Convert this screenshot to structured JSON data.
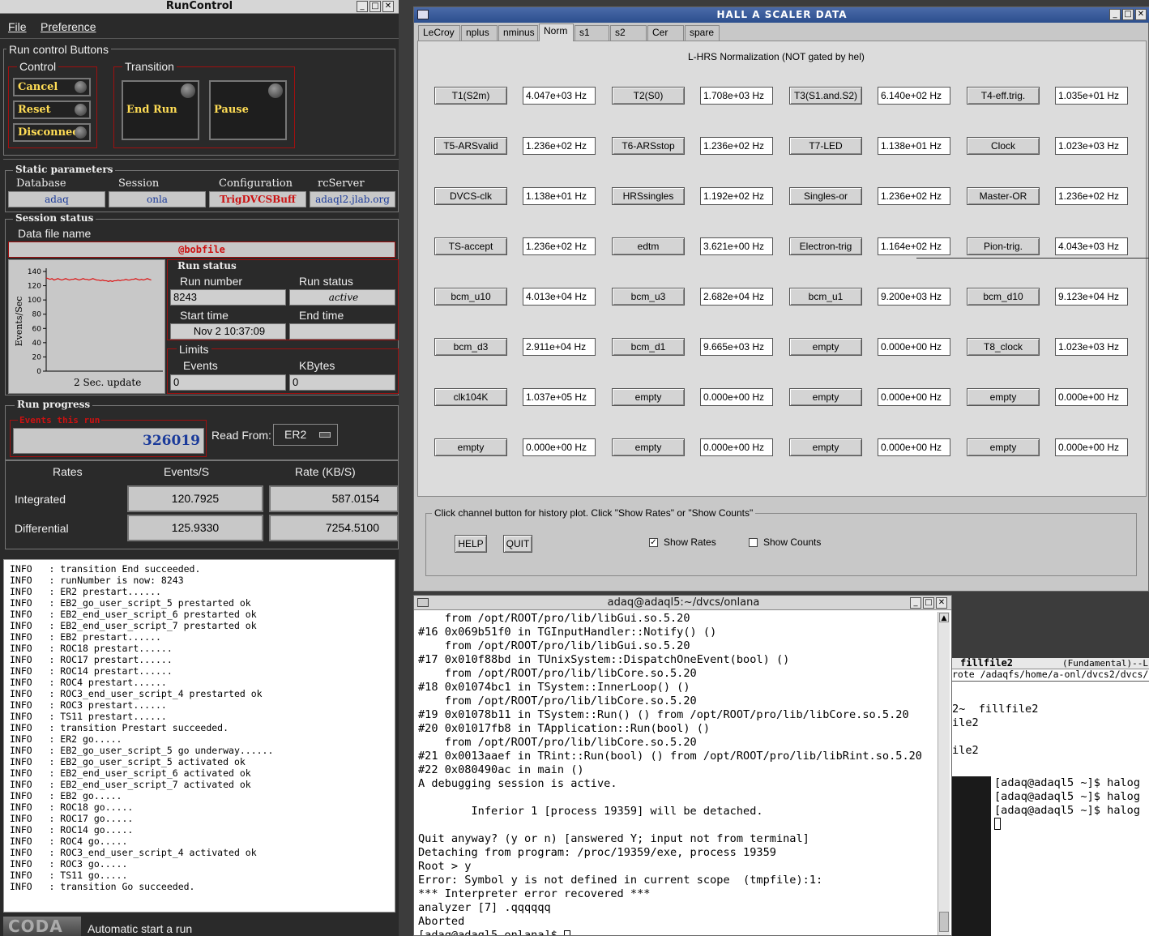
{
  "runcontrol": {
    "title": "RunControl",
    "menu": [
      "File",
      "Preference"
    ],
    "buttons_group": "Run control Buttons",
    "control_group": "Control",
    "cancel": "Cancel",
    "reset": "Reset",
    "disconnect": "Disconnect",
    "transition_group": "Transition",
    "end_run": "End Run",
    "pause": "Pause",
    "static_params": "Static parameters",
    "database_label": "Database",
    "database": "adaq",
    "session_label": "Session",
    "session": "onla",
    "config_label": "Configuration",
    "config": "TrigDVCSBuff",
    "rcserver_label": "rcServer",
    "rcserver": "adaql2.jlab.org",
    "session_status": "Session status",
    "datafile_label": "Data file name",
    "datafile": "@bobfile",
    "chart_update": "2 Sec. update",
    "run_status_group": "Run status",
    "run_number_label": "Run number",
    "run_number": "8243",
    "run_status_label": "Run status",
    "run_status": "active",
    "start_time_label": "Start time",
    "start_time": "Nov 2 10:37:09",
    "end_time_label": "End time",
    "end_time": "",
    "limits_group": "Limits",
    "events_label": "Events",
    "events_limit": "0",
    "kbytes_label": "KBytes",
    "kbytes_limit": "0",
    "run_progress": "Run progress",
    "events_this_run_label": "Events this run",
    "events_this_run": "326019",
    "read_from_label": "Read From:",
    "read_from": "ER2",
    "rates_label": "Rates",
    "events_s_label": "Events/S",
    "rate_kbs_label": "Rate (KB/S)",
    "integrated_label": "Integrated",
    "integrated_events": "120.7925",
    "integrated_rate": "587.0154",
    "differential_label": "Differential",
    "differential_events": "125.9330",
    "differential_rate": "7254.5100",
    "status_text": "Automatic start a run",
    "log": [
      "INFO   : transition End succeeded.",
      "INFO   : runNumber is now: 8243",
      "INFO   : ER2 prestart......",
      "INFO   : EB2_go_user_script_5 prestarted ok",
      "INFO   : EB2_end_user_script_6 prestarted ok",
      "INFO   : EB2_end_user_script_7 prestarted ok",
      "INFO   : EB2 prestart......",
      "INFO   : ROC18 prestart......",
      "INFO   : ROC17 prestart......",
      "INFO   : ROC14 prestart......",
      "INFO   : ROC4 prestart......",
      "INFO   : ROC3_end_user_script_4 prestarted ok",
      "INFO   : ROC3 prestart......",
      "INFO   : TS11 prestart......",
      "INFO   : transition Prestart succeeded.",
      "INFO   : ER2 go.....",
      "INFO   : EB2_go_user_script_5 go underway......",
      "INFO   : EB2_go_user_script_5 activated ok",
      "INFO   : EB2_end_user_script_6 activated ok",
      "INFO   : EB2_end_user_script_7 activated ok",
      "INFO   : EB2 go.....",
      "INFO   : ROC18 go.....",
      "INFO   : ROC17 go.....",
      "INFO   : ROC14 go.....",
      "INFO   : ROC4 go.....",
      "INFO   : ROC3_end_user_script_4 activated ok",
      "INFO   : ROC3 go.....",
      "INFO   : TS11 go.....",
      "INFO   : transition Go succeeded."
    ]
  },
  "chart_data": {
    "type": "line",
    "ylabel": "Events/Sec",
    "ylim": [
      0,
      140
    ],
    "yticks": [
      0,
      20,
      40,
      60,
      80,
      100,
      120,
      140
    ],
    "x": [
      0,
      1,
      2,
      3,
      4,
      5,
      6,
      7,
      8,
      9,
      10,
      11,
      12,
      13,
      14,
      15,
      16,
      17,
      18,
      19,
      20,
      21,
      22,
      23,
      24,
      25,
      26,
      27,
      28,
      29,
      30,
      31,
      32,
      33,
      34,
      35,
      36,
      37,
      38,
      39,
      40,
      41,
      42,
      43,
      44,
      45,
      46,
      47,
      48,
      49,
      50,
      51,
      52,
      53,
      54
    ],
    "values": [
      131,
      130,
      129,
      130,
      128,
      129,
      130,
      129,
      128,
      129,
      130,
      129,
      128,
      129,
      129,
      130,
      129,
      128,
      129,
      130,
      129,
      129,
      128,
      129,
      130,
      129,
      128,
      128,
      127,
      128,
      127,
      127,
      126,
      127,
      126,
      127,
      127,
      128,
      127,
      128,
      128,
      129,
      128,
      128,
      129,
      129,
      130,
      129,
      128,
      129,
      128,
      129,
      130,
      129,
      128
    ],
    "xlim": [
      0,
      60
    ],
    "color": "#dd1111"
  },
  "scaler": {
    "title": "HALL  A  SCALER  DATA",
    "tabs": [
      "LeCroy",
      "nplus",
      "nminus",
      "Norm",
      "s1",
      "s2",
      "Cer",
      "spare"
    ],
    "active_tab": 3,
    "heading": "L-HRS Normalization (NOT gated by hel)",
    "rows": [
      [
        [
          "T1(S2m)",
          "4.047e+03 Hz"
        ],
        [
          "T2(S0)",
          "1.708e+03 Hz"
        ],
        [
          "T3(S1.and.S2)",
          "6.140e+02 Hz"
        ],
        [
          "T4-eff.trig.",
          "1.035e+01 Hz"
        ]
      ],
      [
        [
          "T5-ARSvalid",
          "1.236e+02 Hz"
        ],
        [
          "T6-ARSstop",
          "1.236e+02 Hz"
        ],
        [
          "T7-LED",
          "1.138e+01 Hz"
        ],
        [
          "Clock",
          "1.023e+03 Hz"
        ]
      ],
      [
        [
          "DVCS-clk",
          "1.138e+01 Hz"
        ],
        [
          "HRSsingles",
          "1.192e+02 Hz"
        ],
        [
          "Singles-or",
          "1.236e+02 Hz"
        ],
        [
          "Master-OR",
          "1.236e+02 Hz"
        ]
      ],
      [
        [
          "TS-accept",
          "1.236e+02 Hz"
        ],
        [
          "edtm",
          "3.621e+00 Hz"
        ],
        [
          "Electron-trig",
          "1.164e+02 Hz"
        ],
        [
          "Pion-trig.",
          "4.043e+03 Hz"
        ]
      ],
      [
        [
          "bcm_u10",
          "4.013e+04 Hz"
        ],
        [
          "bcm_u3",
          "2.682e+04 Hz"
        ],
        [
          "bcm_u1",
          "9.200e+03 Hz"
        ],
        [
          "bcm_d10",
          "9.123e+04 Hz"
        ]
      ],
      [
        [
          "bcm_d3",
          "2.911e+04 Hz"
        ],
        [
          "bcm_d1",
          "9.665e+03 Hz"
        ],
        [
          "empty",
          "0.000e+00 Hz"
        ],
        [
          "T8_clock",
          "1.023e+03 Hz"
        ]
      ],
      [
        [
          "clk104K",
          "1.037e+05 Hz"
        ],
        [
          "empty",
          "0.000e+00 Hz"
        ],
        [
          "empty",
          "0.000e+00 Hz"
        ],
        [
          "empty",
          "0.000e+00 Hz"
        ]
      ],
      [
        [
          "empty",
          "0.000e+00 Hz"
        ],
        [
          "empty",
          "0.000e+00 Hz"
        ],
        [
          "empty",
          "0.000e+00 Hz"
        ],
        [
          "empty",
          "0.000e+00 Hz"
        ]
      ]
    ],
    "help_text": "Click channel button for history plot.  Click \"Show Rates\" or \"Show Counts\"",
    "help": "HELP",
    "quit": "QUIT",
    "show_rates": "Show Rates",
    "show_rates_checked": true,
    "show_counts": "Show Counts",
    "show_counts_checked": false
  },
  "terminal": {
    "title": "adaq@adaql5:~/dvcs/onlana",
    "lines": [
      "    from /opt/ROOT/pro/lib/libGui.so.5.20",
      "#16 0x069b51f0 in TGInputHandler::Notify() ()",
      "    from /opt/ROOT/pro/lib/libGui.so.5.20",
      "#17 0x010f88bd in TUnixSystem::DispatchOneEvent(bool) ()",
      "    from /opt/ROOT/pro/lib/libCore.so.5.20",
      "#18 0x01074bc1 in TSystem::InnerLoop() ()",
      "    from /opt/ROOT/pro/lib/libCore.so.5.20",
      "#19 0x01078b11 in TSystem::Run() () from /opt/ROOT/pro/lib/libCore.so.5.20",
      "#20 0x01017fb8 in TApplication::Run(bool) ()",
      "    from /opt/ROOT/pro/lib/libCore.so.5.20",
      "#21 0x0013aaef in TRint::Run(bool) () from /opt/ROOT/pro/lib/libRint.so.5.20",
      "#22 0x080490ac in main ()",
      "A debugging session is active.",
      "",
      "        Inferior 1 [process 19359] will be detached.",
      "",
      "Quit anyway? (y or n) [answered Y; input not from terminal]",
      "Detaching from program: /proc/19359/exe, process 19359",
      "Root > y",
      "Error: Symbol y is not defined in current scope  (tmpfile):1:",
      "*** Interpreter error recovered ***",
      "analyzer [7] .qqqqqq",
      "Aborted",
      "[adaq@adaql5 onlana]$ "
    ]
  },
  "bg_term": {
    "header_left": "fillfile2",
    "header_right": "(Fundamental)--L",
    "path_line": "rote /adaqfs/home/a-onl/dvcs2/dvcs/",
    "lines": [
      "2~  fillfile2",
      "ile2",
      "",
      "ile2"
    ]
  },
  "bg_term2": {
    "lines": [
      "[adaq@adaql5 ~]$ halog",
      "[adaq@adaql5 ~]$ halog",
      "[adaq@adaql5 ~]$ halog"
    ]
  }
}
